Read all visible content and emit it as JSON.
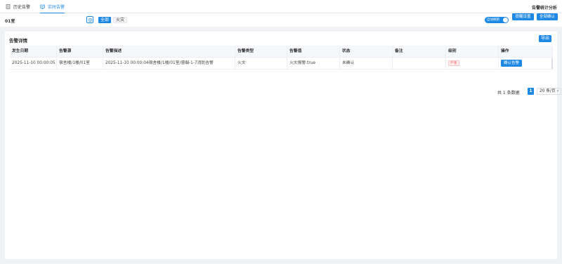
{
  "tabs": [
    {
      "label": "历史告警",
      "icon": "document-icon",
      "active": false
    },
    {
      "label": "实时告警",
      "icon": "monitor-icon",
      "active": true
    }
  ],
  "stats_link": "告警统计分析",
  "filter": {
    "room": "01室",
    "target_icon": "target-icon",
    "chips": [
      {
        "label": "全部",
        "selected": true
      },
      {
        "label": "火灾",
        "selected": false
      }
    ],
    "auto_refresh_label": "自动刷新",
    "auto_refresh_on": true,
    "reminder_settings": "提醒设置",
    "confirm_all": "全部确认"
  },
  "card": {
    "title": "告警详情",
    "export_label": "导出"
  },
  "table": {
    "columns": [
      "发生日期",
      "告警源",
      "告警描述",
      "告警类型",
      "告警值",
      "状态",
      "备注",
      "级别",
      "操作"
    ],
    "rows": [
      {
        "date": "2025-11-10 00:00:05",
        "source": "宿舍楼/1楼/01室",
        "description": "2025-11-10 00:00:04宿舍楼/1楼/01室/感烟-1-7消防告警",
        "type": "火灾",
        "value": "火灾报警:true",
        "status": "未确认",
        "remark": "",
        "level": "严重",
        "action": "确认告警"
      }
    ]
  },
  "pagination": {
    "total_text": "共 1 条数据",
    "current_page": "1",
    "page_size": "20 条/页"
  },
  "colors": {
    "primary": "#1e88e5",
    "danger": "#f56c6c",
    "background": "#f0f2f5"
  }
}
